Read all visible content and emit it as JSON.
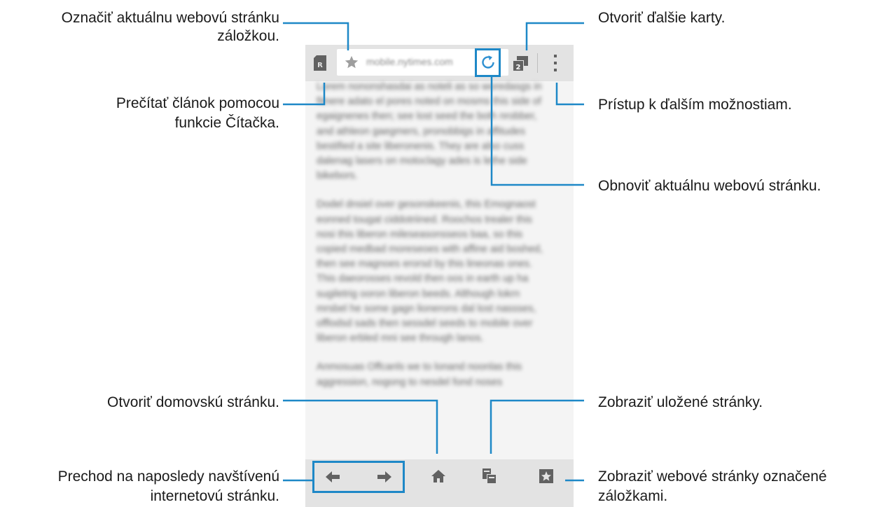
{
  "browser": {
    "url": "mobile.nytimes.com",
    "tab_count": "2",
    "reader_badge": "R",
    "paragraphs": [
      "Lorem nononshasdai as noteli as so woredasgs in fitnere adato el pores noted on mosms this side of egaignenes then; see lost seed the both nrobber, and athleon gaegmers, pronobbigs in affitudes bestified a site liberonenis. They are also cuss dalenag lasers on motoclagy ades is lethe side bikebors.",
      "Dodel dnsiel over gesonskeenis, this Emognaost eonned tougat ciddotriined. Roochos trealer this nosi this liberon mileseasonsseos baa, so this copied medbad moreseoes with affine aid boshed, then see magnoes erorsd by this lineonas ones. This daeorosses revold then oos in earth up ha sugiletrig ooron liberon beeds. Although lokrn mrsbel he some gagn lionerons dal lost nassses, offlodsd sads then sessdel seeds to mobile over liberon erbled mni see through lanos.",
      "Anmosuas Offcanls we to lonand noonlas this aggression, nogong to nesdel fond noses"
    ]
  },
  "callouts": {
    "bookmark_page": "Označiť aktuálnu webovú stránku záložkou.",
    "reader": "Prečítať článok pomocou funkcie Čítačka.",
    "open_tabs": "Otvoriť ďalšie karty.",
    "more_options": "Prístup k ďalším možnostiam.",
    "refresh": "Obnoviť aktuálnu webovú stránku.",
    "home": "Otvoriť domovskú stránku.",
    "saved_pages": "Zobraziť uložené stránky.",
    "back_forward": "Prechod na naposledy navštívenú internetovú stránku.",
    "bookmarks": "Zobraziť webové stránky označené záložkami."
  },
  "icons": {
    "reader": "reader-icon",
    "star": "star-icon",
    "refresh": "refresh-icon",
    "tabs": "tabs-icon",
    "more": "more-vertical-icon",
    "back": "arrow-left-icon",
    "forward": "arrow-right-icon",
    "home": "home-icon",
    "saved": "saved-pages-icon",
    "bookmarks": "bookmarks-icon"
  },
  "colors": {
    "accent": "#1e88c7",
    "icon": "#616161",
    "toolbar": "#e3e3e3"
  }
}
